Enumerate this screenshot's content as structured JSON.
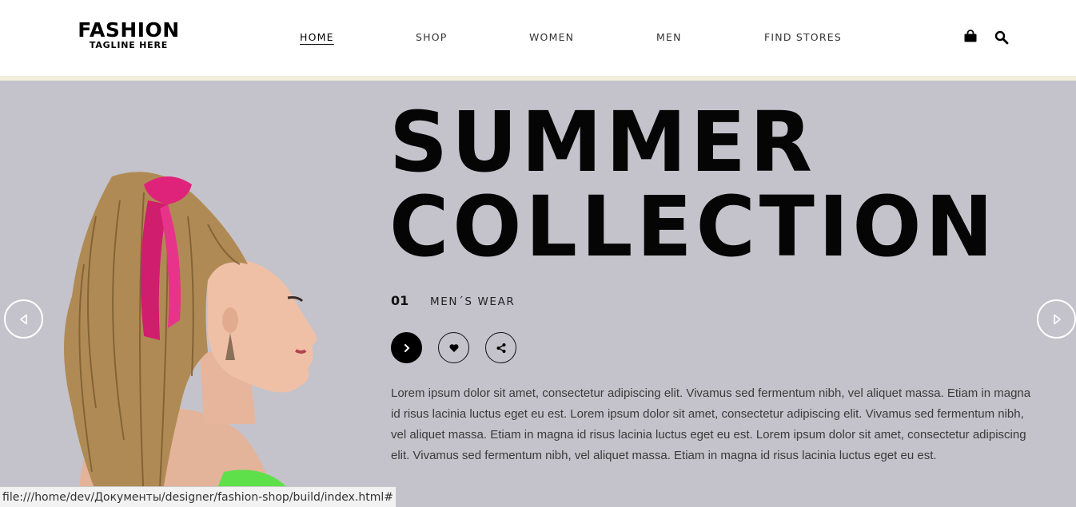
{
  "header": {
    "logo_title": "FASHION",
    "logo_tagline": "TAGLINE HERE",
    "nav": [
      {
        "label": "HOME",
        "active": true
      },
      {
        "label": "SHOP",
        "active": false
      },
      {
        "label": "WOMEN",
        "active": false
      },
      {
        "label": "MEN",
        "active": false
      },
      {
        "label": "FIND STORES",
        "active": false
      }
    ],
    "icons": [
      "shopping-bag-icon",
      "search-icon"
    ]
  },
  "hero": {
    "title_line1": "SUMMER",
    "title_line2": "COLLECTION",
    "slide_number": "01",
    "slide_label": "MEN´S WEAR",
    "actions": [
      "chevron-right-icon",
      "heart-icon",
      "share-icon"
    ],
    "description": "Lorem ipsum dolor sit amet, consectetur adipiscing elit. Vivamus sed fermentum nibh, vel aliquet massa. Etiam in magna id risus lacinia luctus eget eu est. Lorem ipsum dolor sit amet, consectetur adipiscing elit. Vivamus sed fermentum nibh, vel aliquet massa. Etiam in magna id risus lacinia luctus eget eu est. Lorem ipsum dolor sit amet, consectetur adipiscing elit. Vivamus sed fermentum nibh, vel aliquet massa. Etiam in magna id risus lacinia luctus eget eu est.",
    "prev_arrow": "prev-arrow-icon",
    "next_arrow": "next-arrow-icon"
  },
  "status_bar": {
    "url": "file:///home/dev/Документы/designer/fashion-shop/build/index.html#"
  },
  "colors": {
    "hero_background": "#c4c3cb",
    "accent_bar": "#f1eedc",
    "text_dark": "#050505",
    "scarf_pink": "#e0237a",
    "top_green": "#5ee04a"
  }
}
